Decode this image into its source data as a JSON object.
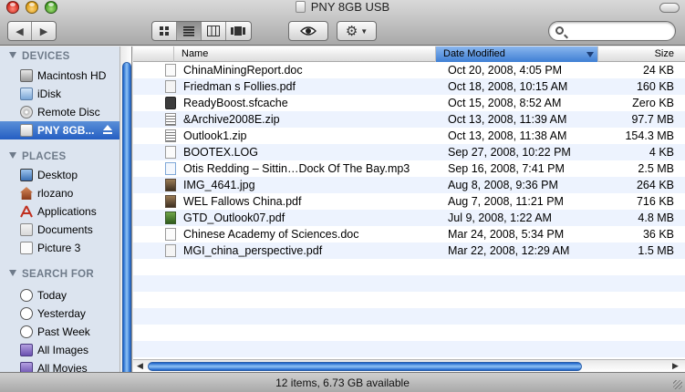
{
  "window": {
    "title": "PNY 8GB USB"
  },
  "toolbar": {
    "back_icon": "back-arrow-icon",
    "forward_icon": "forward-arrow-icon",
    "views": [
      "icon-view",
      "list-view",
      "column-view",
      "cover-flow-view"
    ],
    "active_view": "list-view",
    "search_placeholder": ""
  },
  "sidebar": {
    "devices_header": "DEVICES",
    "places_header": "PLACES",
    "search_header": "SEARCH FOR",
    "devices": [
      {
        "label": "Macintosh HD",
        "icon": "hard-drive-icon"
      },
      {
        "label": "iDisk",
        "icon": "idisk-icon"
      },
      {
        "label": "Remote Disc",
        "icon": "remote-disc-icon"
      },
      {
        "label": "PNY 8GB...",
        "icon": "usb-drive-icon",
        "selected": true
      }
    ],
    "places": [
      {
        "label": "Desktop",
        "icon": "desktop-icon"
      },
      {
        "label": "rlozano",
        "icon": "home-icon"
      },
      {
        "label": "Applications",
        "icon": "applications-icon"
      },
      {
        "label": "Documents",
        "icon": "documents-icon"
      },
      {
        "label": "Picture 3",
        "icon": "picture-file-icon"
      }
    ],
    "search_for": [
      {
        "label": "Today",
        "icon": "clock-icon"
      },
      {
        "label": "Yesterday",
        "icon": "clock-icon"
      },
      {
        "label": "Past Week",
        "icon": "clock-icon"
      },
      {
        "label": "All Images",
        "icon": "smart-folder-icon"
      },
      {
        "label": "All Movies",
        "icon": "smart-folder-icon"
      }
    ]
  },
  "columns": {
    "name": "Name",
    "date": "Date Modified",
    "size": "Size",
    "sorted_by": "Date Modified"
  },
  "files": [
    {
      "name": "ChinaMiningReport.doc",
      "date": "Oct 20, 2008, 4:05 PM",
      "size": "24 KB",
      "icon": "doc"
    },
    {
      "name": "Friedman s Follies.pdf",
      "date": "Oct 18, 2008, 10:15 AM",
      "size": "160 KB",
      "icon": "pdf"
    },
    {
      "name": "ReadyBoost.sfcache",
      "date": "Oct 15, 2008, 8:52 AM",
      "size": "Zero KB",
      "icon": "dark"
    },
    {
      "name": "&Archive2008E.zip",
      "date": "Oct 13, 2008, 11:39 AM",
      "size": "97.7 MB",
      "icon": "zip"
    },
    {
      "name": "Outlook1.zip",
      "date": "Oct 13, 2008, 11:38 AM",
      "size": "154.3 MB",
      "icon": "zip"
    },
    {
      "name": "BOOTEX.LOG",
      "date": "Sep 27, 2008, 10:22 PM",
      "size": "4 KB",
      "icon": "doc"
    },
    {
      "name": "Otis Redding – Sittin…Dock Of The Bay.mp3",
      "date": "Sep 16, 2008, 7:41 PM",
      "size": "2.5 MB",
      "icon": "audio"
    },
    {
      "name": "IMG_4641.jpg",
      "date": "Aug 8, 2008, 9:36 PM",
      "size": "264 KB",
      "icon": "img"
    },
    {
      "name": "WEL Fallows China.pdf",
      "date": "Aug 7, 2008, 11:21 PM",
      "size": "716 KB",
      "icon": "img"
    },
    {
      "name": "GTD_Outlook07.pdf",
      "date": "Jul 9, 2008, 1:22 AM",
      "size": "4.8 MB",
      "icon": "green"
    },
    {
      "name": "Chinese Academy of Sciences.doc",
      "date": "Mar 24, 2008, 5:34 PM",
      "size": "36 KB",
      "icon": "doc"
    },
    {
      "name": "MGI_china_perspective.pdf",
      "date": "Mar 22, 2008, 12:29 AM",
      "size": "1.5 MB",
      "icon": "pdf"
    }
  ],
  "status": {
    "text": "12 items, 6.73 GB available"
  }
}
